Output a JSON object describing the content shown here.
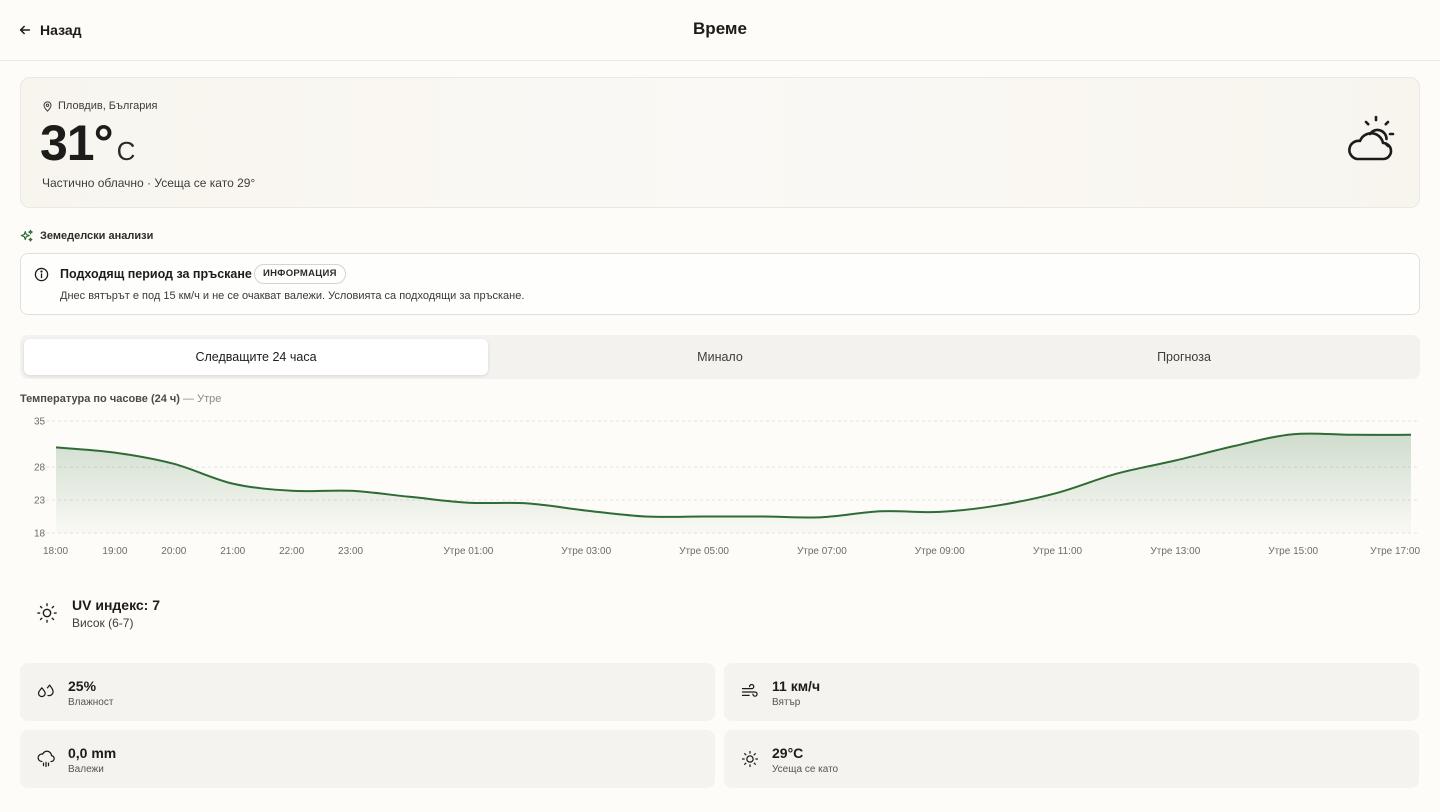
{
  "header": {
    "back_label": "Назад",
    "title": "Време"
  },
  "current": {
    "location": "Пловдив, България",
    "temperature": "31°",
    "unit": "C",
    "condition_line": "Частично облачно · Усеща се като 29°",
    "icon": "partly-cloudy-icon"
  },
  "agri": {
    "heading": "Земеделски анализи",
    "alert": {
      "title": "Подходящ период за пръскане",
      "badge": "ИНФОРМАЦИЯ",
      "description": "Днес вятърът е под 15 км/ч и не се очакват валежи. Условията са подходящи за пръскане."
    }
  },
  "tabs": [
    {
      "label": "Следващите 24 часа",
      "active": true
    },
    {
      "label": "Минало",
      "active": false
    },
    {
      "label": "Прогноза",
      "active": false
    }
  ],
  "chart_title": "Температура по часове (24 ч)",
  "chart_subtitle": "— Утре",
  "chart_data": {
    "type": "area",
    "title": "Температура по часове (24 ч)",
    "xlabel": "",
    "ylabel": "",
    "y_ticks": [
      35,
      28,
      23,
      18
    ],
    "ylim": [
      18,
      35
    ],
    "grid": true,
    "x_ticks": [
      "18:00",
      "19:00",
      "20:00",
      "21:00",
      "22:00",
      "23:00",
      "Утре 01:00",
      "Утре 03:00",
      "Утре 05:00",
      "Утре 07:00",
      "Утре 09:00",
      "Утре 11:00",
      "Утре 13:00",
      "Утре 15:00",
      "Утре 17:00"
    ],
    "x_hours": [
      0,
      1,
      2,
      3,
      4,
      5,
      7,
      9,
      11,
      13,
      15,
      17,
      19,
      21,
      23
    ],
    "series": [
      {
        "color": "#2f6b35",
        "hours": [
          0,
          1,
          2,
          3,
          4,
          5,
          6,
          7,
          8,
          9,
          10,
          11,
          12,
          13,
          14,
          15,
          16,
          17,
          18,
          19,
          20,
          21,
          22,
          23
        ],
        "values": [
          31.0,
          30.2,
          28.5,
          25.5,
          24.4,
          24.4,
          23.5,
          22.6,
          22.5,
          21.4,
          20.5,
          20.5,
          20.5,
          20.4,
          21.3,
          21.2,
          22.2,
          24.1,
          27.0,
          29.0,
          31.2,
          33.0,
          32.9,
          32.9
        ]
      }
    ]
  },
  "uv": {
    "value": "UV индекс: 7",
    "level": "Висок (6-7)"
  },
  "stats": {
    "humidity": {
      "value": "25%",
      "label": "Влажност"
    },
    "wind": {
      "value": "11 км/ч",
      "label": "Вятър"
    },
    "precip": {
      "value": "0,0 mm",
      "label": "Валежи"
    },
    "feels": {
      "value": "29°C",
      "label": "Усеща се като"
    }
  }
}
